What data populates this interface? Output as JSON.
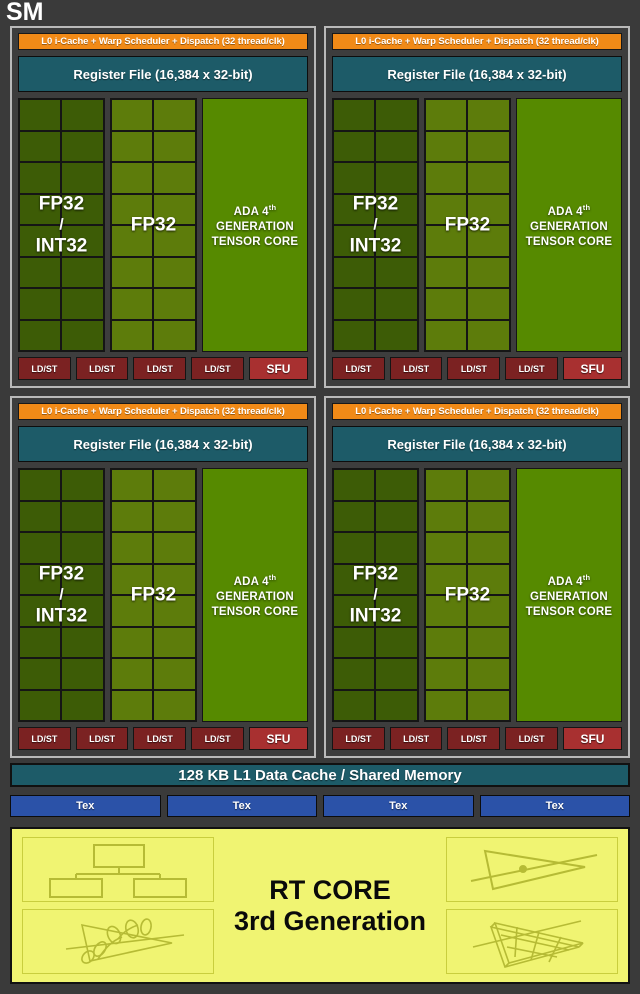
{
  "title": "SM",
  "quadrants": [
    {
      "l0_bar": "L0 i-Cache + Warp Scheduler + Dispatch (32 thread/clk)",
      "register_file": "Register File (16,384 x 32-bit)",
      "core_group_a": "FP32 / INT32",
      "core_group_a_line1": "FP32",
      "core_group_a_slash": "/",
      "core_group_a_line2": "INT32",
      "core_group_b": "FP32",
      "tensor_line1": "ADA 4",
      "tensor_sup": "th",
      "tensor_line2": "GENERATION",
      "tensor_line3": "TENSOR CORE",
      "ldst": [
        "LD/ST",
        "LD/ST",
        "LD/ST",
        "LD/ST"
      ],
      "sfu": "SFU",
      "cells_per_group": 16
    },
    {
      "l0_bar": "L0 i-Cache + Warp Scheduler + Dispatch (32 thread/clk)",
      "register_file": "Register File (16,384 x 32-bit)",
      "core_group_a": "FP32 / INT32",
      "core_group_a_line1": "FP32",
      "core_group_a_slash": "/",
      "core_group_a_line2": "INT32",
      "core_group_b": "FP32",
      "tensor_line1": "ADA 4",
      "tensor_sup": "th",
      "tensor_line2": "GENERATION",
      "tensor_line3": "TENSOR CORE",
      "ldst": [
        "LD/ST",
        "LD/ST",
        "LD/ST",
        "LD/ST"
      ],
      "sfu": "SFU",
      "cells_per_group": 16
    },
    {
      "l0_bar": "L0 i-Cache + Warp Scheduler + Dispatch (32 thread/clk)",
      "register_file": "Register File (16,384 x 32-bit)",
      "core_group_a": "FP32 / INT32",
      "core_group_a_line1": "FP32",
      "core_group_a_slash": "/",
      "core_group_a_line2": "INT32",
      "core_group_b": "FP32",
      "tensor_line1": "ADA 4",
      "tensor_sup": "th",
      "tensor_line2": "GENERATION",
      "tensor_line3": "TENSOR CORE",
      "ldst": [
        "LD/ST",
        "LD/ST",
        "LD/ST",
        "LD/ST"
      ],
      "sfu": "SFU",
      "cells_per_group": 16
    },
    {
      "l0_bar": "L0 i-Cache + Warp Scheduler + Dispatch (32 thread/clk)",
      "register_file": "Register File (16,384 x 32-bit)",
      "core_group_a": "FP32 / INT32",
      "core_group_a_line1": "FP32",
      "core_group_a_slash": "/",
      "core_group_a_line2": "INT32",
      "core_group_b": "FP32",
      "tensor_line1": "ADA 4",
      "tensor_sup": "th",
      "tensor_line2": "GENERATION",
      "tensor_line3": "TENSOR CORE",
      "ldst": [
        "LD/ST",
        "LD/ST",
        "LD/ST",
        "LD/ST"
      ],
      "sfu": "SFU",
      "cells_per_group": 16
    }
  ],
  "l1_cache": "128 KB L1 Data Cache / Shared Memory",
  "tex_units": [
    "Tex",
    "Tex",
    "Tex",
    "Tex"
  ],
  "rt_core": {
    "line1": "RT CORE",
    "line2": "3rd Generation",
    "illustrations": [
      "bvh-tree-icon",
      "opacity-micromap-foliage-icon",
      "ray-triangle-intersection-icon",
      "displaced-micromesh-triangle-icon"
    ]
  },
  "colors": {
    "background": "#3a3a3a",
    "panel_border": "#b9b9b9",
    "l0_orange": "#f18a17",
    "register_teal": "#1d5b68",
    "fp32_int32_green": "#3d5c06",
    "fp32_green": "#5d7c0b",
    "tensor_green": "#568a00",
    "ldst_red": "#7b2222",
    "sfu_red": "#a83030",
    "tex_blue": "#2b52a8",
    "rt_core_yellow": "#f0f472",
    "text_white": "#ffffff",
    "text_black": "#0a0a0a"
  }
}
